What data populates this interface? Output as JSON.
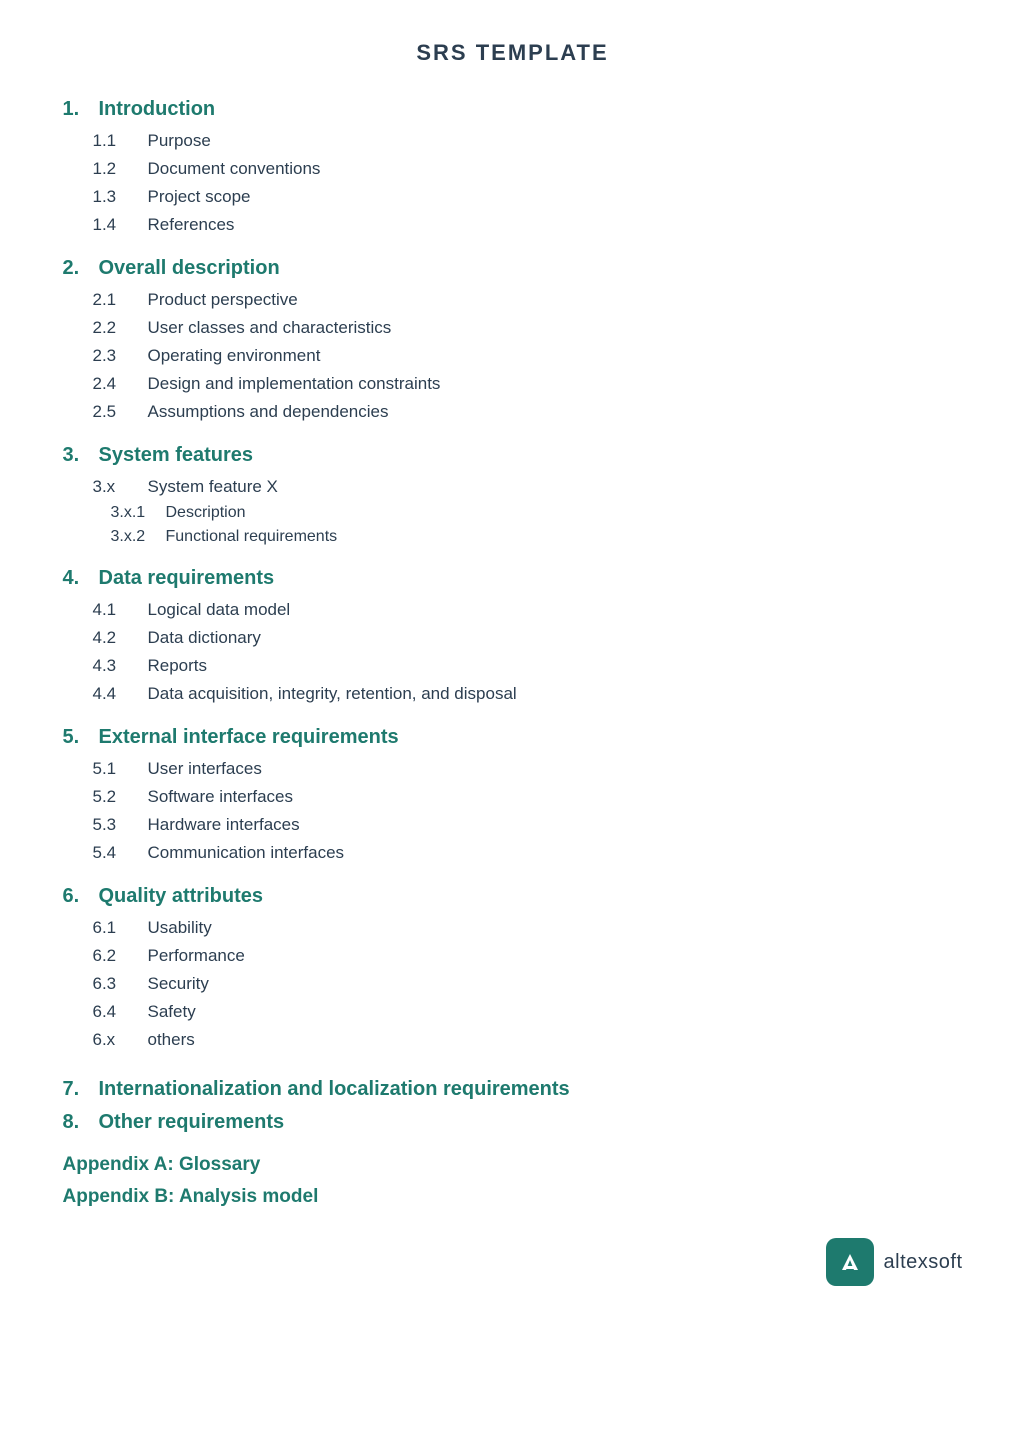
{
  "page": {
    "title": "SRS TEMPLATE"
  },
  "sections": [
    {
      "number": "1.",
      "label": "Introduction",
      "subsections": [
        {
          "number": "1.1",
          "label": "Purpose"
        },
        {
          "number": "1.2",
          "label": "Document conventions"
        },
        {
          "number": "1.3",
          "label": "Project scope"
        },
        {
          "number": "1.4",
          "label": "References"
        }
      ]
    },
    {
      "number": "2.",
      "label": "Overall description",
      "subsections": [
        {
          "number": "2.1",
          "label": "Product perspective"
        },
        {
          "number": "2.2",
          "label": "User classes and characteristics"
        },
        {
          "number": "2.3",
          "label": "Operating environment"
        },
        {
          "number": "2.4",
          "label": "Design and implementation constraints"
        },
        {
          "number": "2.5",
          "label": "Assumptions and dependencies"
        }
      ]
    },
    {
      "number": "3.",
      "label": "System features",
      "subsections": [
        {
          "number": "3.x",
          "label": "System feature X",
          "indent": "normal"
        }
      ],
      "subsubsections": [
        {
          "number": "3.x.1",
          "label": "Description"
        },
        {
          "number": "3.x.2",
          "label": "Functional requirements"
        }
      ]
    },
    {
      "number": "4.",
      "label": "Data requirements",
      "subsections": [
        {
          "number": "4.1",
          "label": "Logical data model"
        },
        {
          "number": "4.2",
          "label": "Data dictionary"
        },
        {
          "number": "4.3",
          "label": "Reports"
        },
        {
          "number": "4.4",
          "label": "Data acquisition, integrity, retention, and disposal"
        }
      ]
    },
    {
      "number": "5.",
      "label": "External interface requirements",
      "subsections": [
        {
          "number": "5.1",
          "label": "User interfaces"
        },
        {
          "number": "5.2",
          "label": "Software interfaces"
        },
        {
          "number": "5.3",
          "label": "Hardware interfaces"
        },
        {
          "number": "5.4",
          "label": "Communication interfaces"
        }
      ]
    },
    {
      "number": "6.",
      "label": "Quality attributes",
      "subsections": [
        {
          "number": "6.1",
          "label": "Usability"
        },
        {
          "number": "6.2",
          "label": "Performance"
        },
        {
          "number": "6.3",
          "label": "Security"
        },
        {
          "number": "6.4",
          "label": "Safety"
        },
        {
          "number": "6.x",
          "label": "others"
        }
      ]
    },
    {
      "number": "7.",
      "label": "Internationalization and localization requirements",
      "subsections": []
    },
    {
      "number": "8.",
      "label": "Other requirements",
      "subsections": []
    }
  ],
  "appendices": [
    {
      "label": "Appendix A: Glossary"
    },
    {
      "label": "Appendix B: Analysis model"
    }
  ],
  "logo": {
    "text": "altexsoft"
  }
}
